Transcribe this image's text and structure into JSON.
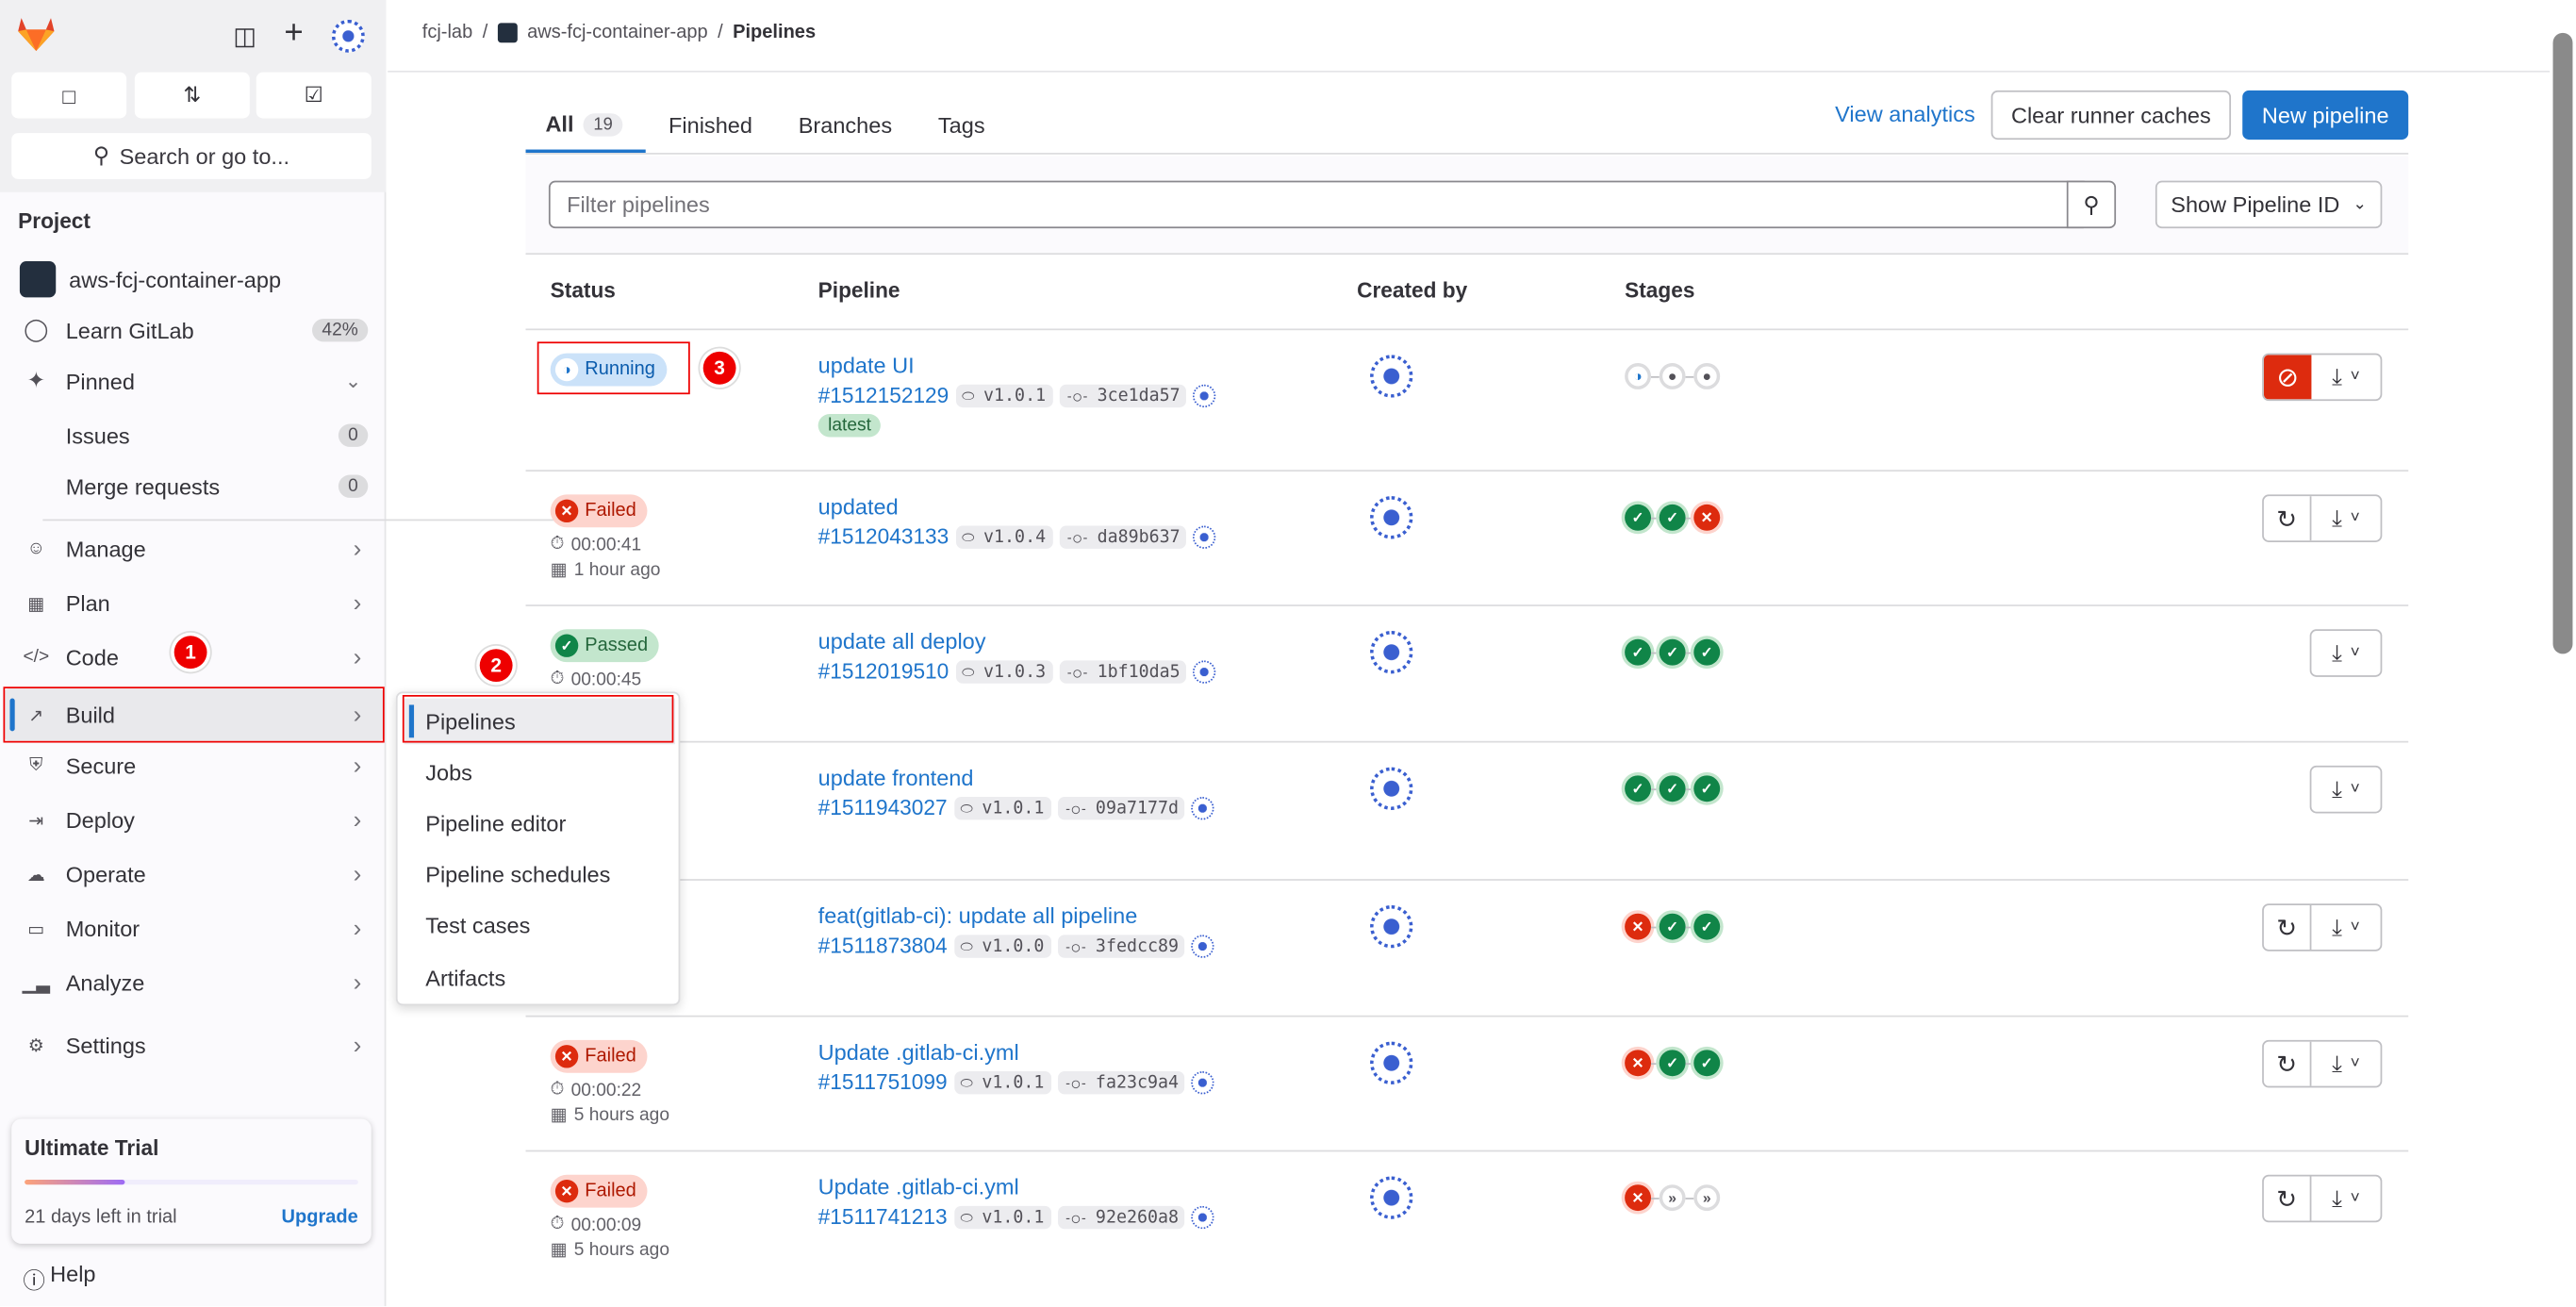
{
  "sidebar": {
    "search_placeholder": "Search or go to...",
    "section_title": "Project",
    "project_name": "aws-fcj-container-app",
    "learn": {
      "label": "Learn GitLab",
      "percent": "42%"
    },
    "pinned": {
      "label": "Pinned",
      "items": [
        {
          "label": "Issues",
          "count": "0"
        },
        {
          "label": "Merge requests",
          "count": "0"
        }
      ]
    },
    "items": [
      {
        "label": "Manage",
        "icon": "users-icon"
      },
      {
        "label": "Plan",
        "icon": "calendar-icon"
      },
      {
        "label": "Code",
        "icon": "code-icon"
      },
      {
        "label": "Build",
        "icon": "rocket-icon",
        "active": true
      },
      {
        "label": "Secure",
        "icon": "shield-icon"
      },
      {
        "label": "Deploy",
        "icon": "deploy-icon"
      },
      {
        "label": "Operate",
        "icon": "cloud-gear-icon"
      },
      {
        "label": "Monitor",
        "icon": "monitor-icon"
      },
      {
        "label": "Analyze",
        "icon": "chart-icon"
      },
      {
        "label": "Settings",
        "icon": "gear-icon"
      }
    ],
    "trial": {
      "title": "Ultimate Trial",
      "progress_percent": 30,
      "days_left": "21 days left in trial",
      "upgrade": "Upgrade"
    },
    "help": "Help"
  },
  "build_menu": {
    "items": [
      "Pipelines",
      "Jobs",
      "Pipeline editor",
      "Pipeline schedules",
      "Test cases",
      "Artifacts"
    ],
    "selected": "Pipelines"
  },
  "annotations": [
    "1",
    "2",
    "3"
  ],
  "breadcrumb": [
    "fcj-lab",
    "aws-fcj-container-app",
    "Pipelines"
  ],
  "tabs": [
    {
      "label": "All",
      "count": "19",
      "active": true
    },
    {
      "label": "Finished"
    },
    {
      "label": "Branches"
    },
    {
      "label": "Tags"
    }
  ],
  "toolbar": {
    "view_analytics": "View analytics",
    "clear_caches": "Clear runner caches",
    "new_pipeline": "New pipeline"
  },
  "filter": {
    "placeholder": "Filter pipelines",
    "id_dropdown": "Show Pipeline ID"
  },
  "table": {
    "headers": [
      "Status",
      "Pipeline",
      "Created by",
      "Stages"
    ],
    "rows": [
      {
        "status": "Running",
        "duration": "",
        "time": "",
        "title": "update UI",
        "id": "#1512152129",
        "tag": "v1.0.1",
        "commit": "3ce1da57",
        "latest": "latest",
        "stages": [
          "running",
          "created",
          "created"
        ],
        "actions": [
          "cancel",
          "download"
        ]
      },
      {
        "status": "Failed",
        "duration": "00:00:41",
        "time": "1 hour ago",
        "title": "updated",
        "id": "#1512043133",
        "tag": "v1.0.4",
        "commit": "da89b637",
        "stages": [
          "success",
          "success",
          "failed"
        ],
        "actions": [
          "retry",
          "download"
        ]
      },
      {
        "status": "Passed",
        "duration": "00:00:45",
        "time": "",
        "title": "update all deploy",
        "id": "#1512019510",
        "tag": "v1.0.3",
        "commit": "1bf10da5",
        "stages": [
          "success",
          "success",
          "success"
        ],
        "actions": [
          "download"
        ]
      },
      {
        "status": "",
        "duration": "",
        "time": "",
        "title": "update frontend",
        "id": "#1511943027",
        "tag": "v1.0.1",
        "commit": "09a7177d",
        "stages": [
          "success",
          "success",
          "success"
        ],
        "actions": [
          "download"
        ]
      },
      {
        "status": "",
        "duration": "",
        "time": "",
        "title": "feat(gitlab-ci): update all pipeline",
        "id": "#1511873804",
        "tag": "v1.0.0",
        "commit": "3fedcc89",
        "stages": [
          "failed",
          "success",
          "success"
        ],
        "actions": [
          "retry",
          "download"
        ]
      },
      {
        "status": "Failed",
        "duration": "00:00:22",
        "time": "5 hours ago",
        "title": "Update .gitlab-ci.yml",
        "id": "#1511751099",
        "tag": "v1.0.1",
        "commit": "fa23c9a4",
        "stages": [
          "failed",
          "success",
          "success"
        ],
        "actions": [
          "retry",
          "download"
        ]
      },
      {
        "status": "Failed",
        "duration": "00:00:09",
        "time": "5 hours ago",
        "title": "Update .gitlab-ci.yml",
        "id": "#1511741213",
        "tag": "v1.0.1",
        "commit": "92e260a8",
        "stages": [
          "failed",
          "skipped",
          "skipped"
        ],
        "actions": [
          "retry",
          "download"
        ]
      }
    ]
  },
  "colors": {
    "accent": "#1f75cb",
    "success": "#108548",
    "failed": "#dd2b0e",
    "running": "#1f75cb",
    "annotation": "#ee0000"
  }
}
